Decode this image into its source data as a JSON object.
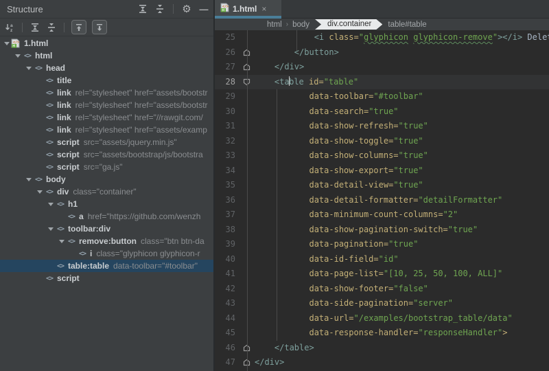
{
  "colors": {
    "panel_bg": "#3C3F41",
    "editor_bg": "#2B2B2B",
    "caret_line_bg": "#323334",
    "tree_selection_bg": "#25455F",
    "tag_color": "#7EA09D",
    "attr_name_color": "#C4B077",
    "string_color": "#6FA551",
    "line_number_color": "#606366",
    "tab_underline_color": "#4A7E99",
    "breadcrumb_badge_bg": "#E8EAEB"
  },
  "structure_panel": {
    "title": "Structure",
    "header_icons": [
      "expand-all-icon",
      "collapse-all-icon",
      "separator",
      "settings-gear-icon",
      "hide-panel-icon"
    ],
    "toolbar_icons": [
      "sort-alphabetically-icon",
      "separator",
      "expand-all-icon",
      "collapse-all-icon",
      "separator",
      "autoscroll-to-source-toggle",
      "autoscroll-from-source-toggle"
    ],
    "tree": [
      {
        "level": 0,
        "expanded": true,
        "icon": "html-file-icon",
        "label": "1.html",
        "attrs": "",
        "selected": false
      },
      {
        "level": 1,
        "expanded": true,
        "icon": "tag-icon",
        "label": "html",
        "attrs": "",
        "selected": false
      },
      {
        "level": 2,
        "expanded": true,
        "icon": "tag-icon",
        "label": "head",
        "attrs": "",
        "selected": false
      },
      {
        "level": 3,
        "expanded": false,
        "icon": "tag-icon",
        "label": "title",
        "attrs": "",
        "selected": false
      },
      {
        "level": 3,
        "expanded": false,
        "icon": "tag-icon",
        "label": "link",
        "attrs": "rel=\"stylesheet\" href=\"assets/bootstr",
        "selected": false
      },
      {
        "level": 3,
        "expanded": false,
        "icon": "tag-icon",
        "label": "link",
        "attrs": "rel=\"stylesheet\" href=\"assets/bootstr",
        "selected": false
      },
      {
        "level": 3,
        "expanded": false,
        "icon": "tag-icon",
        "label": "link",
        "attrs": "rel=\"stylesheet\" href=\"//rawgit.com/",
        "selected": false
      },
      {
        "level": 3,
        "expanded": false,
        "icon": "tag-icon",
        "label": "link",
        "attrs": "rel=\"stylesheet\" href=\"assets/examp",
        "selected": false
      },
      {
        "level": 3,
        "expanded": false,
        "icon": "tag-icon",
        "label": "script",
        "attrs": "src=\"assets/jquery.min.js\"",
        "selected": false
      },
      {
        "level": 3,
        "expanded": false,
        "icon": "tag-icon",
        "label": "script",
        "attrs": "src=\"assets/bootstrap/js/bootstra",
        "selected": false
      },
      {
        "level": 3,
        "expanded": false,
        "icon": "tag-icon",
        "label": "script",
        "attrs": "src=\"ga.js\"",
        "selected": false
      },
      {
        "level": 2,
        "expanded": true,
        "icon": "tag-icon",
        "label": "body",
        "attrs": "",
        "selected": false
      },
      {
        "level": 3,
        "expanded": true,
        "icon": "tag-icon",
        "label": "div",
        "attrs": "class=\"container\"",
        "selected": false
      },
      {
        "level": 4,
        "expanded": true,
        "icon": "tag-icon",
        "label": "h1",
        "attrs": "",
        "selected": false
      },
      {
        "level": 5,
        "expanded": false,
        "icon": "tag-icon",
        "label": "a",
        "attrs": "href=\"https://github.com/wenzh",
        "selected": false
      },
      {
        "level": 4,
        "expanded": true,
        "icon": "tag-icon",
        "label": "toolbar:div",
        "attrs": "",
        "selected": false
      },
      {
        "level": 5,
        "expanded": true,
        "icon": "tag-icon",
        "label": "remove:button",
        "attrs": "class=\"btn btn-da",
        "selected": false
      },
      {
        "level": 6,
        "expanded": false,
        "icon": "tag-icon",
        "label": "i",
        "attrs": "class=\"glyphicon glyphicon-r",
        "selected": false
      },
      {
        "level": 4,
        "expanded": false,
        "icon": "tag-icon",
        "label": "table:table",
        "attrs": "data-toolbar=\"#toolbar\"",
        "selected": true
      },
      {
        "level": 3,
        "expanded": false,
        "icon": "tag-icon",
        "label": "script",
        "attrs": "",
        "selected": false
      }
    ]
  },
  "editor": {
    "tab": {
      "label": "1.html",
      "close_glyph": "×",
      "icon": "html-file-icon"
    },
    "breadcrumbs": [
      {
        "label": "html",
        "active": false
      },
      {
        "label": "body",
        "active": false
      },
      {
        "label": "div.container",
        "active": true
      },
      {
        "label": "table#table",
        "active": false
      }
    ],
    "code": {
      "first_line": 25,
      "last_line": 47,
      "lines": [
        {
          "n": 25,
          "fold": "",
          "caret": false,
          "tokens": [
            [
              "plain",
              "            "
            ],
            [
              "tag",
              "<i"
            ],
            [
              "attr",
              " class="
            ],
            [
              "str",
              "\""
            ],
            [
              "typo",
              "glyphicon"
            ],
            [
              "str",
              " "
            ],
            [
              "typo",
              "glyphicon-remove"
            ],
            [
              "str",
              "\""
            ],
            [
              "tag",
              "></i>"
            ],
            [
              "plain",
              " Delete"
            ]
          ]
        },
        {
          "n": 26,
          "fold": "end",
          "caret": false,
          "tokens": [
            [
              "plain",
              "        "
            ],
            [
              "tag",
              "</button>"
            ]
          ]
        },
        {
          "n": 27,
          "fold": "end",
          "caret": false,
          "tokens": [
            [
              "plain",
              "    "
            ],
            [
              "tag",
              "</div>"
            ]
          ]
        },
        {
          "n": 28,
          "fold": "start",
          "caret": true,
          "tokens": [
            [
              "plain",
              "    "
            ],
            [
              "tag",
              "<ta"
            ],
            [
              "caret",
              ""
            ],
            [
              "tag",
              "ble"
            ],
            [
              "attr",
              " id="
            ],
            [
              "str",
              "\"table\""
            ]
          ]
        },
        {
          "n": 29,
          "fold": "",
          "caret": false,
          "tokens": [
            [
              "plain",
              "           "
            ],
            [
              "attr",
              "data-toolbar="
            ],
            [
              "str",
              "\"#toolbar\""
            ]
          ]
        },
        {
          "n": 30,
          "fold": "",
          "caret": false,
          "tokens": [
            [
              "plain",
              "           "
            ],
            [
              "attr",
              "data-search="
            ],
            [
              "str",
              "\"true\""
            ]
          ]
        },
        {
          "n": 31,
          "fold": "",
          "caret": false,
          "tokens": [
            [
              "plain",
              "           "
            ],
            [
              "attr",
              "data-show-refresh="
            ],
            [
              "str",
              "\"true\""
            ]
          ]
        },
        {
          "n": 32,
          "fold": "",
          "caret": false,
          "tokens": [
            [
              "plain",
              "           "
            ],
            [
              "attr",
              "data-show-toggle="
            ],
            [
              "str",
              "\"true\""
            ]
          ]
        },
        {
          "n": 33,
          "fold": "",
          "caret": false,
          "tokens": [
            [
              "plain",
              "           "
            ],
            [
              "attr",
              "data-show-columns="
            ],
            [
              "str",
              "\"true\""
            ]
          ]
        },
        {
          "n": 34,
          "fold": "",
          "caret": false,
          "tokens": [
            [
              "plain",
              "           "
            ],
            [
              "attr",
              "data-show-export="
            ],
            [
              "str",
              "\"true\""
            ]
          ]
        },
        {
          "n": 35,
          "fold": "",
          "caret": false,
          "tokens": [
            [
              "plain",
              "           "
            ],
            [
              "attr",
              "data-detail-view="
            ],
            [
              "str",
              "\"true\""
            ]
          ]
        },
        {
          "n": 36,
          "fold": "",
          "caret": false,
          "tokens": [
            [
              "plain",
              "           "
            ],
            [
              "attr",
              "data-detail-formatter="
            ],
            [
              "str",
              "\"detailFormatter\""
            ]
          ]
        },
        {
          "n": 37,
          "fold": "",
          "caret": false,
          "tokens": [
            [
              "plain",
              "           "
            ],
            [
              "attr",
              "data-minimum-count-columns="
            ],
            [
              "str",
              "\"2\""
            ]
          ]
        },
        {
          "n": 38,
          "fold": "",
          "caret": false,
          "tokens": [
            [
              "plain",
              "           "
            ],
            [
              "attr",
              "data-show-pagination-switch="
            ],
            [
              "str",
              "\"true\""
            ]
          ]
        },
        {
          "n": 39,
          "fold": "",
          "caret": false,
          "tokens": [
            [
              "plain",
              "           "
            ],
            [
              "attr",
              "data-pagination="
            ],
            [
              "str",
              "\"true\""
            ]
          ]
        },
        {
          "n": 40,
          "fold": "",
          "caret": false,
          "tokens": [
            [
              "plain",
              "           "
            ],
            [
              "attr",
              "data-id-field="
            ],
            [
              "str",
              "\"id\""
            ]
          ]
        },
        {
          "n": 41,
          "fold": "",
          "caret": false,
          "tokens": [
            [
              "plain",
              "           "
            ],
            [
              "attr",
              "data-page-list="
            ],
            [
              "str",
              "\"[10, 25, 50, 100, ALL]\""
            ]
          ]
        },
        {
          "n": 42,
          "fold": "",
          "caret": false,
          "tokens": [
            [
              "plain",
              "           "
            ],
            [
              "attr",
              "data-show-footer="
            ],
            [
              "str",
              "\"false\""
            ]
          ]
        },
        {
          "n": 43,
          "fold": "",
          "caret": false,
          "tokens": [
            [
              "plain",
              "           "
            ],
            [
              "attr",
              "data-side-pagination="
            ],
            [
              "str",
              "\"server\""
            ]
          ]
        },
        {
          "n": 44,
          "fold": "",
          "caret": false,
          "tokens": [
            [
              "plain",
              "           "
            ],
            [
              "attr",
              "data-url="
            ],
            [
              "str",
              "\"/examples/bootstrap_table/data\""
            ]
          ]
        },
        {
          "n": 45,
          "fold": "",
          "caret": false,
          "tokens": [
            [
              "plain",
              "           "
            ],
            [
              "attr",
              "data-response-handler="
            ],
            [
              "str",
              "\"responseHandler\""
            ],
            [
              "attr",
              ">"
            ]
          ]
        },
        {
          "n": 46,
          "fold": "end",
          "caret": false,
          "tokens": [
            [
              "plain",
              "    "
            ],
            [
              "tag",
              "</table>"
            ]
          ]
        },
        {
          "n": 47,
          "fold": "end",
          "caret": false,
          "tokens": [
            [
              "tag",
              "</div>"
            ]
          ]
        }
      ]
    }
  }
}
